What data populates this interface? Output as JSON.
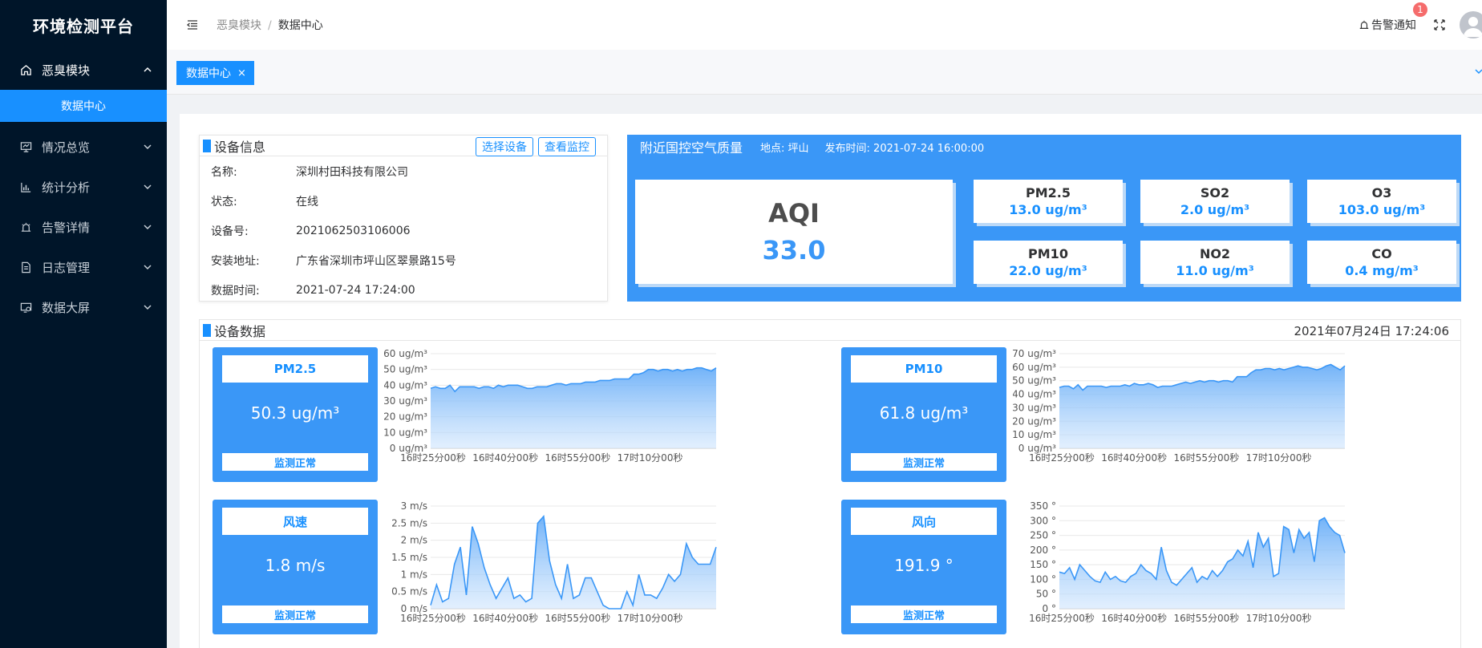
{
  "sidebar": {
    "brand": "环境检测平台",
    "items": [
      {
        "label": "恶臭模块",
        "icon": "home-icon",
        "open": true
      },
      {
        "label": "情况总览",
        "icon": "monitor-icon"
      },
      {
        "label": "统计分析",
        "icon": "bar-chart-icon"
      },
      {
        "label": "告警详情",
        "icon": "alarm-icon"
      },
      {
        "label": "日志管理",
        "icon": "document-icon"
      },
      {
        "label": "数据大屏",
        "icon": "screen-icon"
      }
    ],
    "submenu": {
      "label": "数据中心"
    }
  },
  "header": {
    "breadcrumb": [
      "恶臭模块",
      "/",
      "数据中心"
    ],
    "alarm_label": "告警通知",
    "alarm_count": "1"
  },
  "tags": {
    "active": "数据中心",
    "close": "×"
  },
  "device_info": {
    "title": "设备信息",
    "select_btn": "选择设备",
    "monitor_btn": "查看监控",
    "rows": [
      {
        "k": "名称:",
        "v": "深圳村田科技有限公司"
      },
      {
        "k": "状态:",
        "v": "在线"
      },
      {
        "k": "设备号:",
        "v": "2021062503106006"
      },
      {
        "k": "安装地址:",
        "v": "广东省深圳市坪山区翠景路15号"
      },
      {
        "k": "数据时间:",
        "v": "2021-07-24 17:24:00"
      }
    ]
  },
  "air_quality": {
    "title": "附近国控空气质量",
    "location": "地点: 坪山",
    "publish": "发布时间: 2021-07-24 16:00:00",
    "aqi_label": "AQI",
    "aqi_value": "33.0",
    "pollutants": [
      {
        "name": "PM2.5",
        "value": "13.0 ug/m³"
      },
      {
        "name": "SO2",
        "value": "2.0 ug/m³"
      },
      {
        "name": "O3",
        "value": "103.0 ug/m³"
      },
      {
        "name": "PM10",
        "value": "22.0 ug/m³"
      },
      {
        "name": "NO2",
        "value": "11.0 ug/m³"
      },
      {
        "name": "CO",
        "value": "0.4 mg/m³"
      }
    ]
  },
  "device_data": {
    "title": "设备数据",
    "time": "2021年07月24日 17:24:06",
    "metrics": [
      {
        "name": "PM2.5",
        "value": "50.3 ug/m³",
        "status": "监测正常"
      },
      {
        "name": "PM10",
        "value": "61.8 ug/m³",
        "status": "监测正常"
      },
      {
        "name": "风速",
        "value": "1.8 m/s",
        "status": "监测正常"
      },
      {
        "name": "风向",
        "value": "191.9 °",
        "status": "监测正常"
      }
    ]
  },
  "chart_data": [
    {
      "type": "area",
      "xticks": [
        "16时25分00秒",
        "16时40分00秒",
        "16时55分00秒",
        "17时10分00秒"
      ],
      "yticks": [
        "0 ug/m³",
        "10 ug/m³",
        "20 ug/m³",
        "30 ug/m³",
        "40 ug/m³",
        "50 ug/m³",
        "60 ug/m³"
      ],
      "ylim": [
        0,
        60
      ],
      "values": [
        38,
        39,
        38,
        38,
        40,
        36,
        39,
        39,
        39,
        39,
        38,
        39,
        39,
        38,
        40,
        39,
        40,
        40,
        40,
        39,
        38,
        38,
        39,
        39,
        39,
        40,
        41,
        41,
        40,
        41,
        41,
        41,
        42,
        42,
        42,
        43,
        43,
        43,
        44,
        44,
        44,
        44,
        47,
        47,
        48,
        50,
        50,
        49,
        50,
        50,
        49,
        50,
        49,
        50,
        50,
        51,
        51,
        50,
        49,
        51
      ]
    },
    {
      "type": "area",
      "xticks": [
        "16时25分00秒",
        "16时40分00秒",
        "16时55分00秒",
        "17时10分00秒"
      ],
      "yticks": [
        "0 ug/m³",
        "10 ug/m³",
        "20 ug/m³",
        "30 ug/m³",
        "40 ug/m³",
        "50 ug/m³",
        "60 ug/m³",
        "70 ug/m³"
      ],
      "ylim": [
        0,
        70
      ],
      "values": [
        45,
        46,
        46,
        44,
        47,
        43,
        46,
        46,
        46,
        46,
        45,
        46,
        46,
        46,
        47,
        46,
        48,
        47,
        47,
        48,
        47,
        45,
        46,
        46,
        46,
        47,
        48,
        49,
        48,
        49,
        50,
        49,
        50,
        50,
        49,
        50,
        50,
        49,
        53,
        53,
        53,
        56,
        58,
        58,
        59,
        59,
        58,
        59,
        58,
        59,
        60,
        61,
        60,
        60,
        59,
        58,
        59,
        61,
        62,
        60,
        58,
        61
      ]
    },
    {
      "type": "area",
      "xticks": [
        "16时25分00秒",
        "16时40分00秒",
        "16时55分00秒",
        "17时10分00秒"
      ],
      "yticks": [
        "0 m/s",
        "0.5 m/s",
        "1 m/s",
        "1.5 m/s",
        "2 m/s",
        "2.5 m/s",
        "3 m/s"
      ],
      "ylim": [
        0,
        3
      ],
      "values": [
        0.1,
        0.7,
        0.2,
        0.3,
        1.3,
        1.8,
        0.4,
        2.4,
        1.9,
        1.2,
        0.7,
        0.3,
        0.6,
        0.9,
        0.3,
        0.4,
        0.2,
        0.3,
        2.5,
        2.7,
        1.4,
        0.7,
        0.3,
        1.3,
        0.3,
        0.4,
        0.9,
        0.9,
        0.5,
        0.1,
        0.0,
        0.0,
        0.0,
        0.5,
        0.1,
        1.0,
        0.4,
        0.4,
        0.3,
        0.6,
        1.0,
        0.8,
        1.0,
        1.9,
        1.5,
        1.3,
        1.3,
        1.3,
        1.8
      ]
    },
    {
      "type": "area",
      "xticks": [
        "16时25分00秒",
        "16时40分00秒",
        "16时55分00秒",
        "17时10分00秒"
      ],
      "yticks": [
        "0 °",
        "50 °",
        "100 °",
        "150 °",
        "200 °",
        "250 °",
        "300 °",
        "350 °"
      ],
      "ylim": [
        0,
        350
      ],
      "values": [
        125,
        120,
        140,
        100,
        150,
        130,
        110,
        95,
        90,
        125,
        100,
        110,
        95,
        90,
        110,
        120,
        150,
        130,
        120,
        100,
        210,
        130,
        90,
        80,
        100,
        120,
        140,
        90,
        110,
        100,
        130,
        110,
        130,
        160,
        170,
        200,
        180,
        230,
        140,
        260,
        210,
        240,
        110,
        120,
        280,
        270,
        190,
        270,
        240,
        260,
        160,
        300,
        310,
        280,
        260,
        250,
        190
      ]
    }
  ]
}
